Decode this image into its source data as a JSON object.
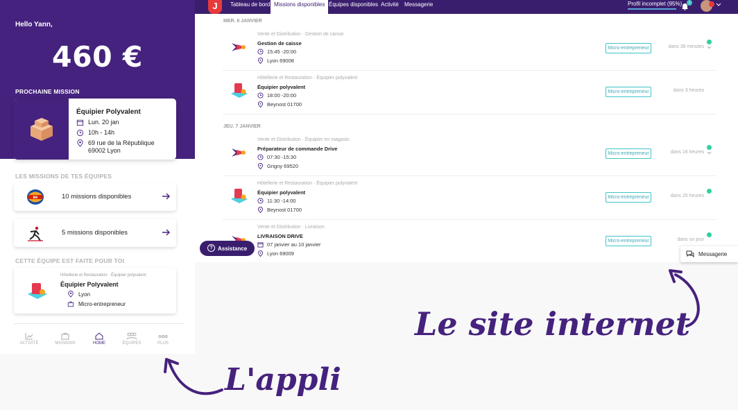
{
  "app": {
    "greeting": "Hello Yann,",
    "balance": "460 €",
    "next_mission": {
      "section_title": "PROCHAINE MISSION",
      "title": "Équipier Polyvalent",
      "date": "Lun. 20 jan",
      "time": "10h - 14h",
      "address_line1": "69 rue de la République",
      "address_line2": "69002 Lyon"
    },
    "teams": {
      "section_title": "LES MISSIONS DE TES ÉQUIPES",
      "items": [
        {
          "label": "10 missions disponibles",
          "logo": "burger-king-logo"
        },
        {
          "label": "5 missions disponibles",
          "logo": "running-man-logo"
        }
      ]
    },
    "recommended": {
      "section_title": "CETTE ÉQUIPE EST FAITE POUR TOI",
      "category": "Hôtellerie et Restauration · Équipier polyvalent",
      "title": "Équipier Polyvalent",
      "city": "Lyon",
      "status": "Micro-entrepreneur"
    },
    "nav": [
      {
        "label": "ACTIVITÉ",
        "icon": "chart-icon"
      },
      {
        "label": "MISSIONS",
        "icon": "briefcase-icon"
      },
      {
        "label": "HOME",
        "icon": "home-icon"
      },
      {
        "label": "ÉQUIPES",
        "icon": "team-icon"
      },
      {
        "label": "PLUS",
        "icon": "more-icon"
      }
    ]
  },
  "site": {
    "brand": "J",
    "tabs": [
      "Tableau de bord",
      "Missions disponibles",
      "Équipes disponibles",
      "Activité",
      "Messagerie"
    ],
    "active_tab": "Missions disponibles",
    "profile": "Profil incomplet (95%)",
    "notif_count": "1",
    "days": [
      {
        "label": "MER. 6 JANVIER",
        "missions": [
          {
            "category": "Vente et Distribution · Gestion de caisse",
            "title": "Gestion de caisse",
            "time": "15:45 -20:00",
            "place": "Lyon 69008",
            "status": "Micro-entrepreneur",
            "when": "dans 38 minutes"
          },
          {
            "category": "Hôtellerie et Restauration · Équipier polyvalent",
            "title": "Équipier polyvalent",
            "time": "18:00 -20:00",
            "place": "Beynost 01700",
            "status": "Micro-entrepreneur",
            "when": "dans 3 heures"
          }
        ]
      },
      {
        "label": "JEU. 7 JANVIER",
        "missions": [
          {
            "category": "Vente et Distribution · Équipier en magasin",
            "title": "Préparateur de commande Drive",
            "time": "07:30 -15:30",
            "place": "Grigny 69520",
            "status": "Micro-entrepreneur",
            "when": "dans 16 heures"
          },
          {
            "category": "Hôtellerie et Restauration · Équipier polyvalent",
            "title": "Équipier polyvalent",
            "time": "11:30 -14:00",
            "place": "Beynost 01700",
            "status": "Micro-entrepreneur",
            "when": "dans 20 heures"
          },
          {
            "category": "Vente et Distribution · Livraison",
            "title": "LIVRAISON DRIVE",
            "time": "07 janvier au 10 janvier",
            "place": "Lyon 69009",
            "status": "Micro-entrepreneur",
            "when": "dans un jour"
          }
        ]
      }
    ],
    "assistance": "Assistance",
    "messaging": "Messagerie"
  },
  "captions": {
    "site": "Le site internet",
    "app": "L'appli"
  },
  "colors": {
    "primary": "#45227d",
    "accent": "#3fc3c9",
    "green": "#2fd0a1",
    "red": "#e83a3a"
  }
}
